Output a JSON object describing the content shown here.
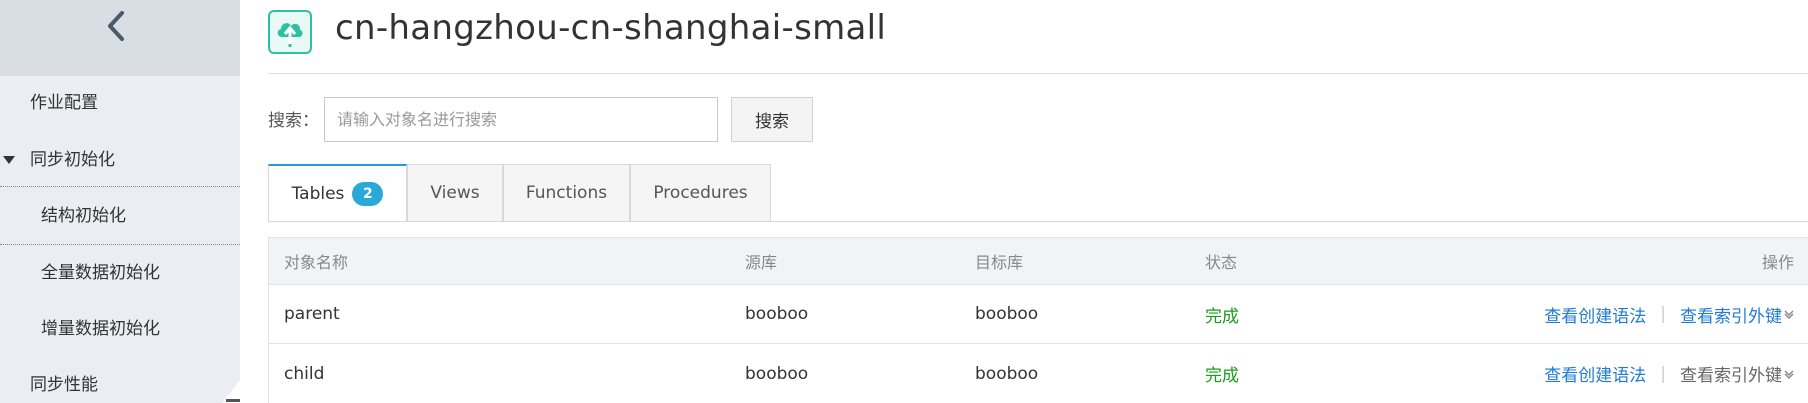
{
  "sidebar": {
    "back_icon": "chevron-left-icon",
    "items": [
      {
        "label": "作业配置"
      },
      {
        "label": "同步初始化"
      },
      {
        "label": "结构初始化"
      },
      {
        "label": "全量数据初始化"
      },
      {
        "label": "增量数据初始化"
      },
      {
        "label": "同步性能"
      }
    ]
  },
  "header": {
    "logo_icon": "cloud-sync-icon",
    "title": "cn-hangzhou-cn-shanghai-small"
  },
  "search": {
    "label": "搜索：",
    "placeholder": "请输入对象名进行搜索",
    "button_label": "搜索"
  },
  "tabs": [
    {
      "label": "Tables",
      "badge": "2",
      "active": true
    },
    {
      "label": "Views"
    },
    {
      "label": "Functions"
    },
    {
      "label": "Procedures"
    }
  ],
  "table": {
    "columns": [
      "对象名称",
      "源库",
      "目标库",
      "状态",
      "操作"
    ],
    "rows": [
      {
        "name": "parent",
        "source": "booboo",
        "target": "booboo",
        "status": "完成",
        "op1": "查看创建语法",
        "op2": "查看索引外键"
      },
      {
        "name": "child",
        "source": "booboo",
        "target": "booboo",
        "status": "完成",
        "op1": "查看创建语法",
        "op2": "查看索引外键"
      }
    ]
  },
  "colors": {
    "accent": "#1f9fd6",
    "status_ok": "#1b9d1b",
    "link": "#1f7bd6",
    "badge": "#2aa9d8",
    "logo": "#2fc0a4"
  }
}
